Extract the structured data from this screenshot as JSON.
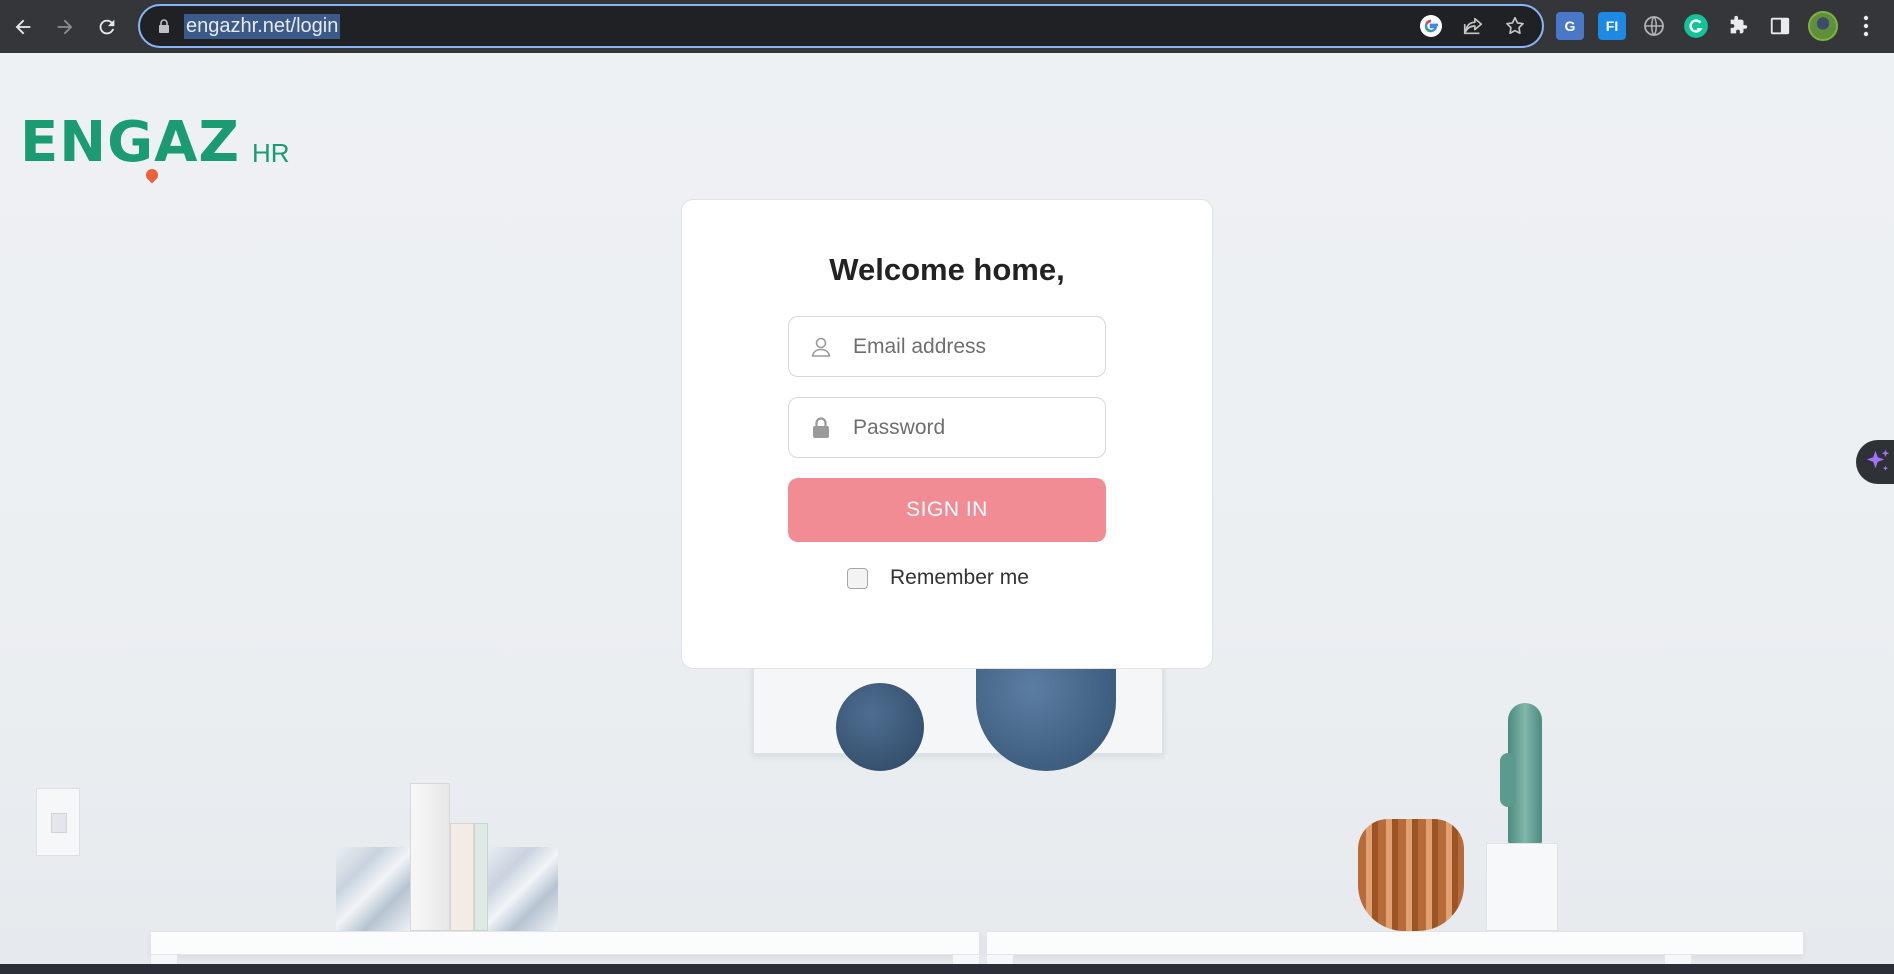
{
  "browser": {
    "url": "engazhr.net/login",
    "icons": [
      "back-icon",
      "forward-icon",
      "reload-icon",
      "lock-icon",
      "google-icon",
      "share-icon",
      "star-icon",
      "translate-extension-icon",
      "fi-extension-icon",
      "globe-extension-icon",
      "grammarly-extension-icon",
      "extensions-puzzle-icon",
      "side-panel-icon",
      "profile-avatar",
      "menu-kebab-icon"
    ],
    "extension_labels": {
      "translate": "G",
      "fi": "FI"
    },
    "colors": {
      "toolbar": "#35363a",
      "omnibox": "#202124",
      "focus_ring": "#8ab4f8"
    }
  },
  "logo": {
    "main": "ENGAZ",
    "sub": "HR",
    "color": "#1a9b72",
    "accent": "#e8623a"
  },
  "login": {
    "title": "Welcome home,",
    "email_placeholder": "Email address",
    "password_placeholder": "Password",
    "signin_label": "SIGN IN",
    "remember_label": "Remember me",
    "signin_color": "#f18c95"
  },
  "side_tab": {
    "icon": "sparkle-icon"
  }
}
